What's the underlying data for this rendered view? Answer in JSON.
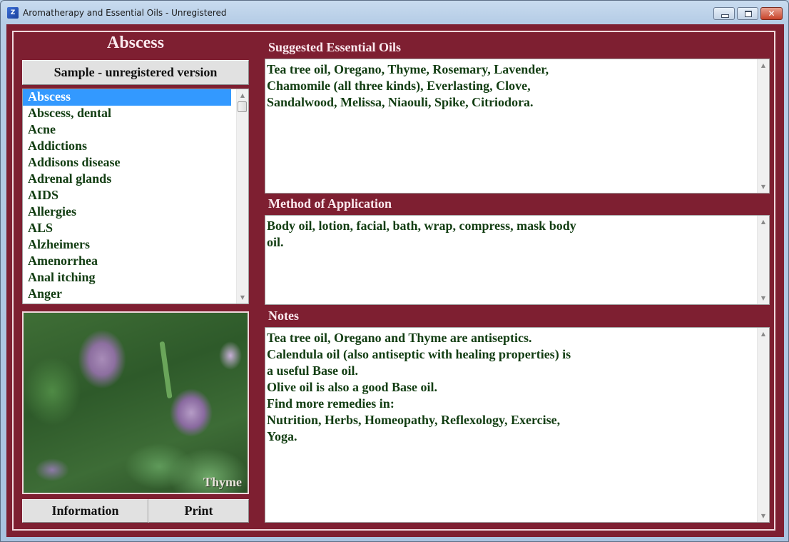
{
  "window": {
    "title": "Aromatherapy and Essential Oils - Unregistered",
    "app_icon_text": "Z",
    "controls": {
      "minimize": "minimize",
      "maximize": "maximize",
      "close": "✕"
    }
  },
  "left_panel": {
    "heading": "Abscess",
    "sample_button": "Sample - unregistered version",
    "conditions": [
      "Abscess",
      "Abscess, dental",
      "Acne",
      "Addictions",
      "Addisons disease",
      "Adrenal glands",
      "AIDS",
      "Allergies",
      "ALS",
      "Alzheimers",
      "Amenorrhea",
      "Anal itching",
      "Anger"
    ],
    "selected_index": 0,
    "photo_caption": "Thyme",
    "information_button": "Information",
    "print_button": "Print"
  },
  "sections": {
    "oils": {
      "label": "Suggested Essential Oils",
      "lines": [
        "Tea tree oil, Oregano, Thyme, Rosemary, Lavender,",
        "Chamomile (all three kinds), Everlasting, Clove,",
        "Sandalwood, Melissa, Niaouli, Spike, Citriodora."
      ]
    },
    "method": {
      "label": "Method of Application",
      "lines": [
        "Body oil, lotion, facial, bath, wrap, compress, mask body",
        "oil."
      ]
    },
    "notes": {
      "label": "Notes",
      "lines": [
        "Tea tree oil, Oregano and Thyme are antiseptics.",
        "Calendula oil (also antiseptic with healing properties) is",
        "a useful Base oil.",
        "Olive oil is also a good Base oil.",
        "Find more remedies in:",
        "Nutrition, Herbs, Homeopathy, Reflexology, Exercise,",
        "Yoga."
      ]
    }
  },
  "scroll_glyphs": {
    "up": "▲",
    "down": "▼"
  },
  "colors": {
    "background": "#7e1f31",
    "text_green": "#123d12",
    "selection": "#3399ff",
    "label_text": "#fbe9ee"
  }
}
